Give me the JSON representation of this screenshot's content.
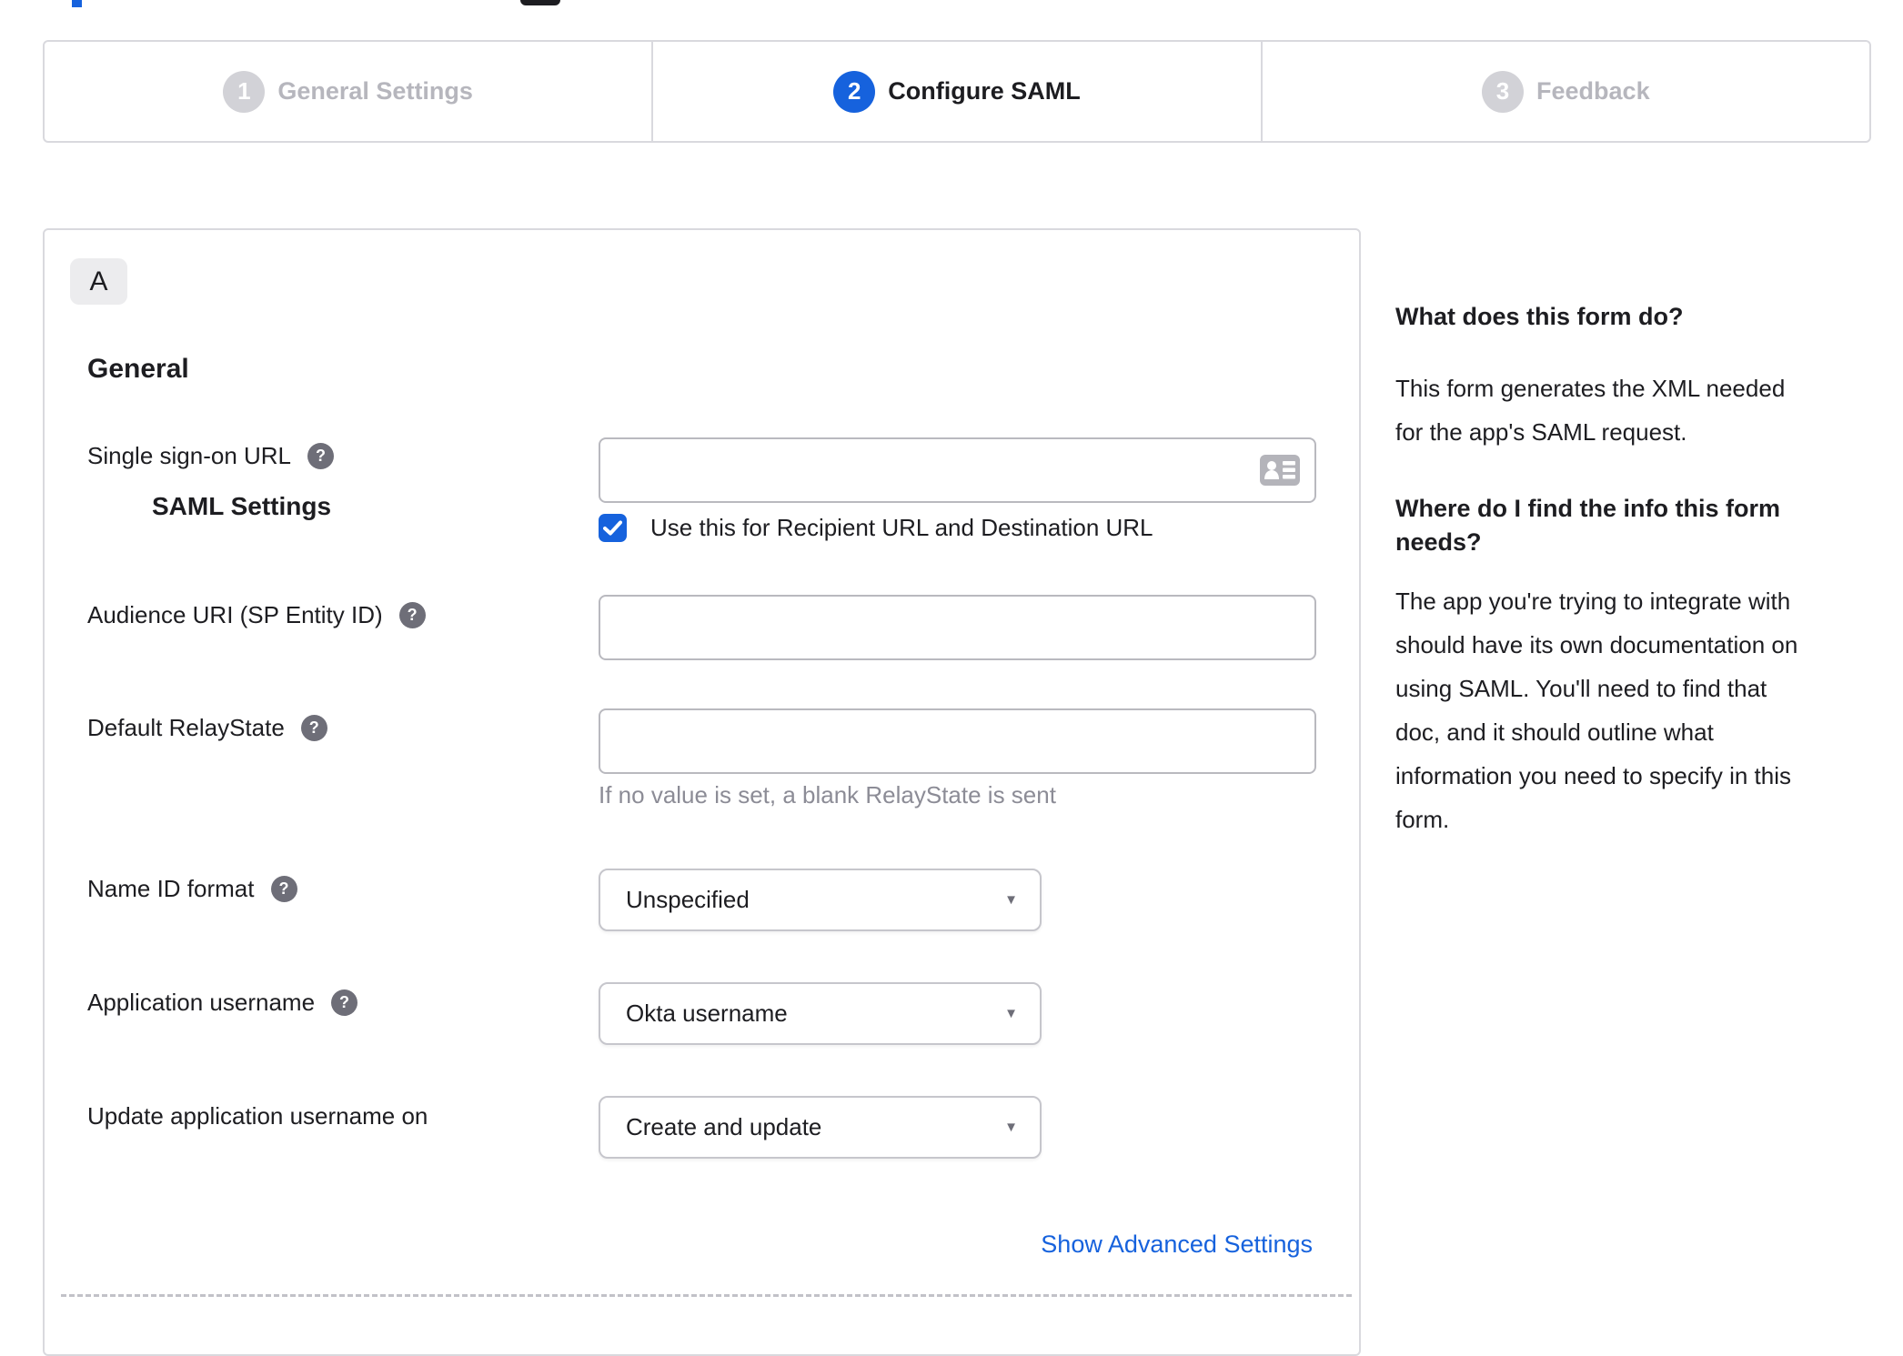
{
  "colors": {
    "accent_blue": "#1662dd",
    "inactive_gray": "#d2d2d7",
    "inactive_text": "#b6b6bd",
    "border_gray": "#d9d9de",
    "hint_gray": "#8c8c96"
  },
  "icons": {
    "help_glyph": "?",
    "caret_glyph": "▼"
  },
  "stepper": {
    "steps": [
      {
        "number": "1",
        "label": "General Settings",
        "state": "inactive"
      },
      {
        "number": "2",
        "label": "Configure SAML",
        "state": "active"
      },
      {
        "number": "3",
        "label": "Feedback",
        "state": "inactive"
      }
    ]
  },
  "saml_panel": {
    "badge": "A",
    "title": "SAML Settings",
    "section_heading": "General",
    "fields": {
      "sso": {
        "label": "Single sign-on URL",
        "value": "",
        "checkbox_label": "Use this for Recipient URL and Destination URL",
        "checkbox_checked": true
      },
      "audience": {
        "label": "Audience URI (SP Entity ID)",
        "value": ""
      },
      "relay": {
        "label": "Default RelayState",
        "value": "",
        "hint": "If no value is set, a blank RelayState is sent"
      },
      "name_id": {
        "label": "Name ID format",
        "value": "Unspecified"
      },
      "app_username": {
        "label": "Application username",
        "value": "Okta username"
      },
      "update_username": {
        "label": "Update application username on",
        "value": "Create and update"
      }
    },
    "advanced_link": "Show Advanced Settings"
  },
  "help_panel": {
    "q1": "What does this form do?",
    "a1": "This form generates the XML needed\nfor the app's SAML request.",
    "q2": "Where do I find the info this form\nneeds?",
    "a2": "The app you're trying to integrate with\nshould have its own documentation on\nusing SAML. You'll need to find that\ndoc, and it should outline what\ninformation you need to specify in this\nform."
  }
}
